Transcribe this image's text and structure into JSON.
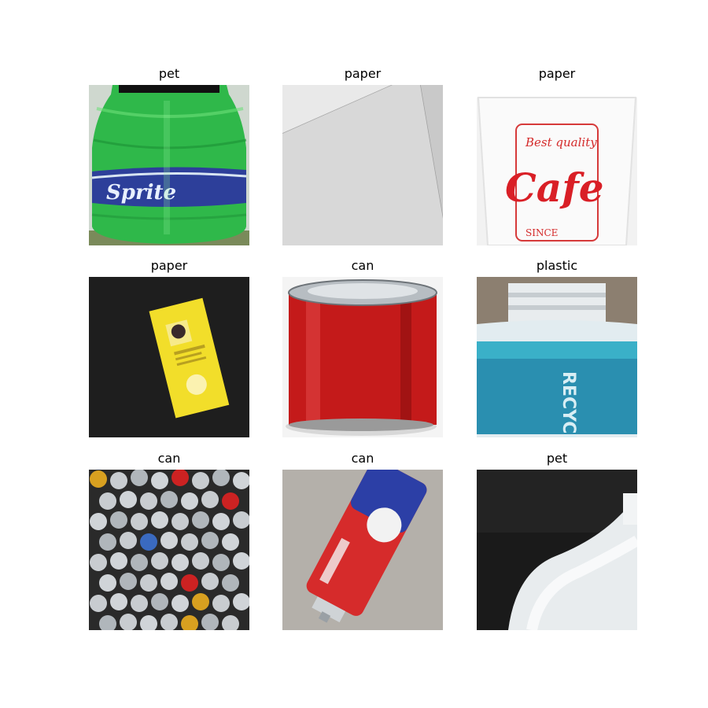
{
  "grid": {
    "items": [
      {
        "label": "pet",
        "image": "green-soda-bottle"
      },
      {
        "label": "paper",
        "image": "white-paper-sheet"
      },
      {
        "label": "paper",
        "image": "paper-coffee-cup"
      },
      {
        "label": "paper",
        "image": "yellow-paper-scrap"
      },
      {
        "label": "can",
        "image": "red-tin-can"
      },
      {
        "label": "plastic",
        "image": "plastic-bottle-blue-label"
      },
      {
        "label": "can",
        "image": "pile-of-cans"
      },
      {
        "label": "can",
        "image": "spray-can"
      },
      {
        "label": "pet",
        "image": "white-bottle-blurred"
      }
    ],
    "image_text": {
      "sprite_logo": "Sprite",
      "cup_tagline": "Best quality",
      "cup_logo": "Cafe",
      "cup_since": "SINCE",
      "bottle_label": "RECYCLE"
    }
  }
}
